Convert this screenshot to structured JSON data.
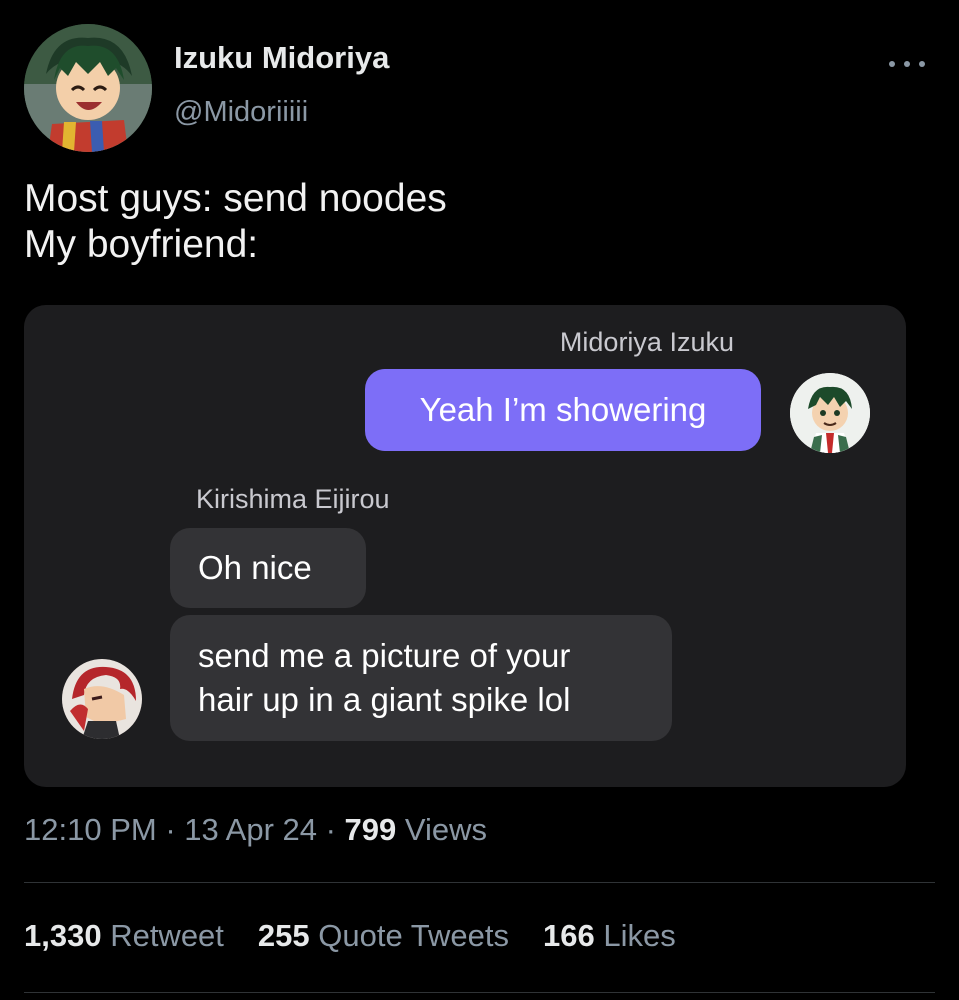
{
  "author": {
    "display_name": "Izuku Midoriya",
    "handle": "@Midoriiiii",
    "avatar_icon": "anime-character-avatar-icon"
  },
  "tweet": {
    "lines": [
      "Most guys: send noodes",
      "My boyfriend:"
    ]
  },
  "chat_screenshot": {
    "right_sender_name": "Midoriya Izuku",
    "right_message": "Yeah I’m showering",
    "left_sender_name": "Kirishima Eijirou",
    "left_messages": [
      "Oh nice"
    ],
    "left_message_multiline": [
      "send me a picture of your",
      "hair up in a giant spike lol"
    ],
    "bubble_purple_color": "#7d6ef7",
    "bubble_gray_color": "#333336"
  },
  "meta": {
    "time": "12:10 PM",
    "separator": " · ",
    "date": "13 Apr 24",
    "views_count": "799",
    "views_label": " Views"
  },
  "stats": {
    "retweets_count": "1,330",
    "retweets_label": " Retweet",
    "quotes_count": "255",
    "quotes_label": " Quote Tweets",
    "likes_count": "166",
    "likes_label": " Likes"
  },
  "icons": {
    "more": "more-options-icon"
  }
}
